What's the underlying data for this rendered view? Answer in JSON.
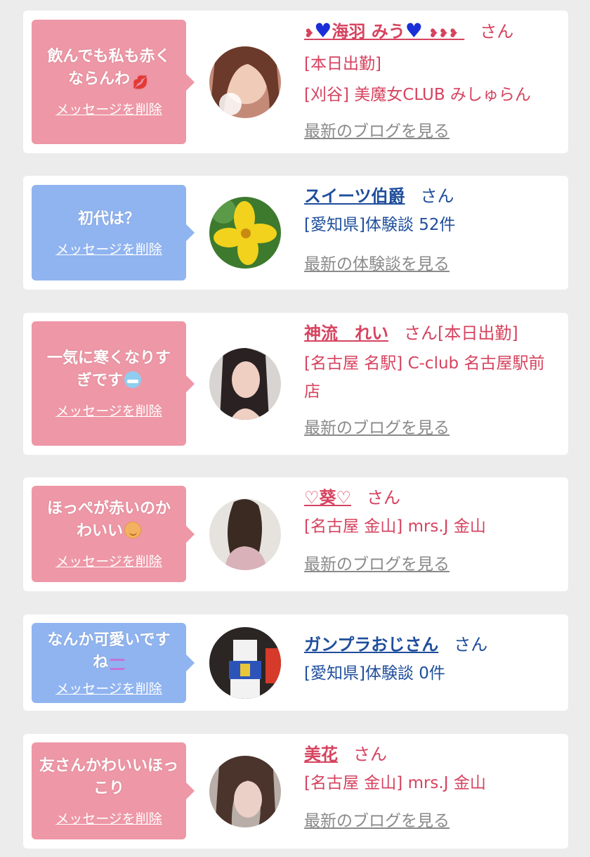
{
  "delete_label": "メッセージを削除",
  "honorific": "さん",
  "cards": [
    {
      "type": "girl",
      "message": "飲んでも私も赤くならんわ",
      "message_emoji": "lips-emoji",
      "name": "海羽 みう",
      "name_decoration_icons": [
        "small-heart-icon",
        "blue-heart-icon",
        "small-hearts-icon"
      ],
      "status": "[本日出勤]",
      "shop": "[刈谷] 美魔女CLUB みしゅらん",
      "link": "最新のブログを見る"
    },
    {
      "type": "reviewer",
      "message": "初代は？",
      "name": "スイーツ伯爵",
      "detail": "[愛知県]体験談 52件",
      "link": "最新の体験談を見る"
    },
    {
      "type": "girl",
      "message": "一気に寒くなりすぎです",
      "message_emoji": "cold-face-emoji",
      "name": "神流　れい",
      "status": "[本日出勤]",
      "shop": "[名古屋 名駅] C-club 名古屋駅前店",
      "link": "最新のブログを見る"
    },
    {
      "type": "girl",
      "message": "ほっぺが赤いのかわいい",
      "message_emoji": "smile-emoji",
      "name": "♡葵♡",
      "shop": "[名古屋 金山] mrs.J 金山",
      "link": "最新のブログを見る"
    },
    {
      "type": "reviewer",
      "message": "なんか可愛いですね",
      "message_emoji": "grimace-emoji",
      "name": "ガンプラおじさん",
      "detail": "[愛知県]体験談 0件"
    },
    {
      "type": "girl",
      "message": "友さんかわいいほっこり",
      "message_emoji": "heart-and-smile-emoji",
      "name": "美花",
      "shop": "[名古屋 金山] mrs.J 金山",
      "link": "最新のブログを見る"
    }
  ],
  "colors": {
    "background": "#ececec",
    "card": "#ffffff",
    "pink_bubble": "#ee97a6",
    "blue_bubble": "#90b4f0",
    "girl_text": "#d6435f",
    "reviewer_text": "#1f4e9c",
    "link_gray": "#8a8a8a"
  }
}
